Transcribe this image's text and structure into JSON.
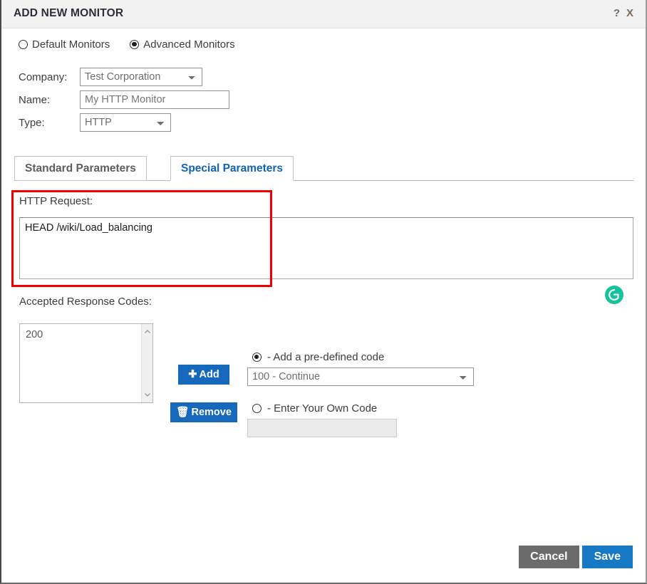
{
  "window": {
    "title": "ADD NEW MONITOR",
    "help_label": "?",
    "close_label": "X"
  },
  "monitor_mode": {
    "options": [
      {
        "label": "Default Monitors",
        "selected": false
      },
      {
        "label": "Advanced Monitors",
        "selected": true
      }
    ]
  },
  "form": {
    "company": {
      "label": "Company:",
      "value": "Test Corporation"
    },
    "name": {
      "label": "Name:",
      "value": "My HTTP Monitor",
      "placeholder": "My HTTP Monitor"
    },
    "type": {
      "label": "Type:",
      "value": "HTTP"
    }
  },
  "tabs": [
    {
      "label": "Standard Parameters",
      "active": false
    },
    {
      "label": "Special Parameters",
      "active": true
    }
  ],
  "http_request": {
    "label": "HTTP Request:",
    "value": "HEAD /wiki/Load_balancing",
    "grammarly_icon": "grammarly-icon"
  },
  "accepted_response_codes": {
    "label": "Accepted Response Codes:",
    "list_items": [
      "200"
    ],
    "add_button": {
      "label": "Add",
      "icon": "plus-icon"
    },
    "remove_button": {
      "label": "Remove",
      "icon": "trash-icon"
    },
    "predefined_radio": {
      "label": "- Add a pre-defined code",
      "selected": true
    },
    "predefined_select": {
      "value": "100 - Continue"
    },
    "own_code_radio": {
      "label": "- Enter Your Own Code",
      "selected": false
    },
    "own_code_input": {
      "value": "",
      "placeholder": ""
    }
  },
  "footer": {
    "cancel_label": "Cancel",
    "save_label": "Save"
  },
  "colors": {
    "accent_blue": "#1668bd",
    "save_blue": "#1779c4",
    "cancel_grey": "#6b6b6b",
    "tab_active_blue": "#1164b4",
    "annotation_red": "#ee0000",
    "grammarly_green": "#15c39a"
  }
}
